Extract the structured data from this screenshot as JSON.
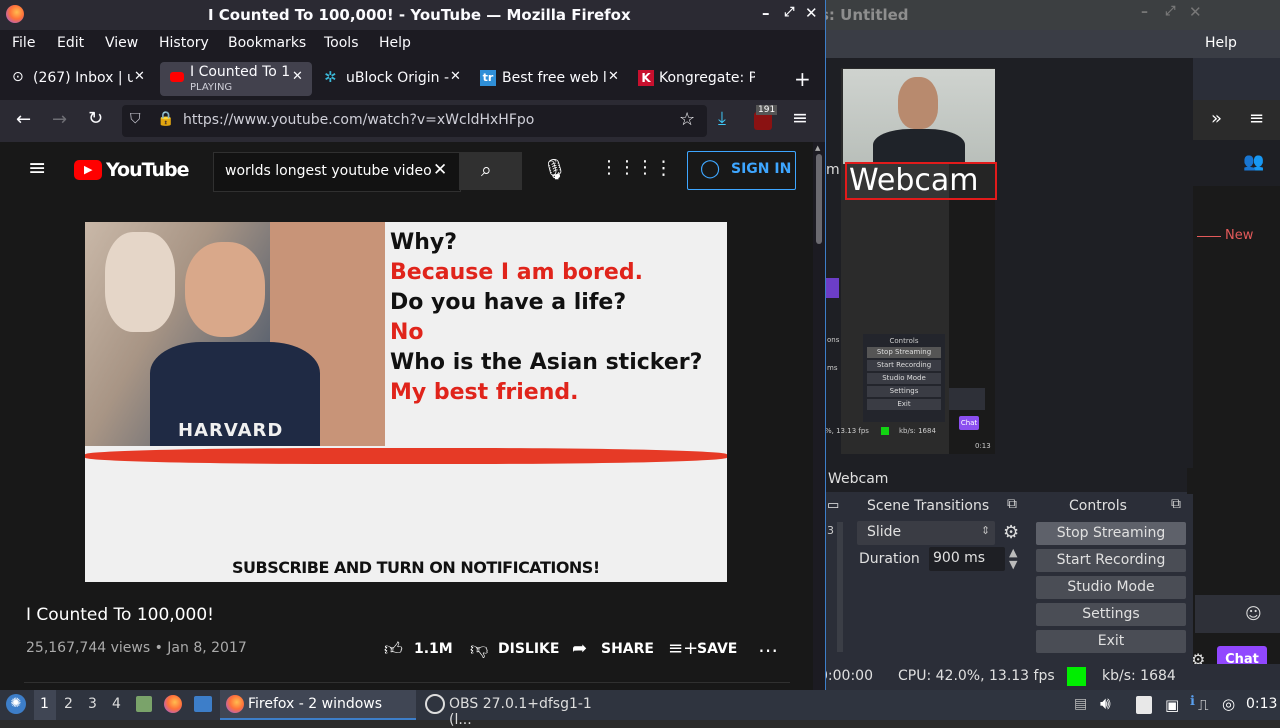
{
  "obs": {
    "title_partial": "s: Untitled",
    "help_menu": "Help",
    "new_label": "New",
    "chat_label": "Chat",
    "webcam_overlay_text": "Webcam",
    "source_name": "Webcam",
    "scene_transitions_header": "Scene Transitions",
    "transition_value": "Slide",
    "duration_label": "Duration",
    "duration_value": "900 ms",
    "controls_header": "Controls",
    "controls": [
      "Stop Streaming",
      "Start Recording",
      "Studio Mode",
      "Settings",
      "Exit"
    ],
    "status_time": "0:00:00",
    "status_cpu": "CPU: 42.0%, 13.13 fps",
    "status_kbs": "kb/s: 1684",
    "mini_controls_header": "Controls",
    "mini_controls": [
      "Stop Streaming",
      "Start Recording",
      "Studio Mode",
      "Settings",
      "Exit"
    ],
    "mini_status": "%, 13.13 fps",
    "mini_kbs": "kb/s: 1684",
    "mini_chat": "Chat",
    "mini_time": "0:13",
    "mini_left1": "ons",
    "mini_left2": "ms"
  },
  "firefox": {
    "window_title": "I Counted To 100,000! - YouTube — Mozilla Firefox",
    "menu": [
      "File",
      "Edit",
      "View",
      "History",
      "Bookmarks",
      "Tools",
      "Help"
    ],
    "tabs": [
      {
        "label": "(267) Inbox | u",
        "sub": ""
      },
      {
        "label": "I Counted To 1(",
        "sub": "PLAYING"
      },
      {
        "label": "uBlock Origin -",
        "sub": ""
      },
      {
        "label": "Best free web l",
        "sub": ""
      },
      {
        "label": "Kongregate: Pl",
        "sub": ""
      }
    ],
    "url": "https://www.youtube.com/watch?v=xWcldHxHFpo",
    "ublock_badge": "191"
  },
  "youtube": {
    "logo_text": "YouTube",
    "search_value": "worlds longest youtube video",
    "sign_in": "SIGN IN",
    "thumbnail_lines": [
      {
        "text": "Why?",
        "color": "#111111"
      },
      {
        "text": "Because I am bored.",
        "color": "#e0241b"
      },
      {
        "text": "Do you have a life?",
        "color": "#111111"
      },
      {
        "text": "No",
        "color": "#e0241b"
      },
      {
        "text": "Who is the Asian sticker?",
        "color": "#111111"
      },
      {
        "text": "My best friend.",
        "color": "#e0241b"
      }
    ],
    "shirt_text": "HARVARD",
    "thumbnail_footer": "SUBSCRIBE AND TURN ON NOTIFICATIONS!",
    "video_title": "I Counted To 100,000!",
    "views_date": "25,167,744 views • Jan 8, 2017",
    "likes": "1.1M",
    "dislike": "DISLIKE",
    "share": "SHARE",
    "save": "SAVE"
  },
  "taskbar": {
    "workspaces": [
      "1",
      "2",
      "3",
      "4"
    ],
    "firefox_task": "Firefox - 2 windows",
    "obs_task": "OBS 27.0.1+dfsg1-1 (l...",
    "clock": "0:13"
  }
}
